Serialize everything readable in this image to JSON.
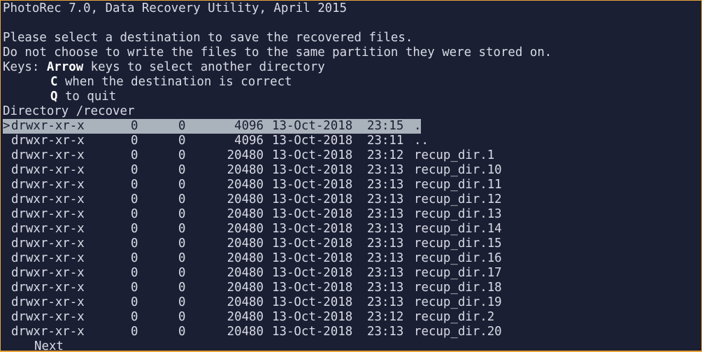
{
  "header": {
    "title": "PhotoRec 7.0, Data Recovery Utility, April 2015",
    "prompt1": "Please select a destination to save the recovered files.",
    "prompt2": "Do not choose to write the files to the same partition they were stored on.",
    "keys_label": "Keys: ",
    "keys": [
      {
        "key": "Arrow",
        "desc": " keys to select another directory"
      },
      {
        "key": "C",
        "desc": " when the destination is correct"
      },
      {
        "key": "Q",
        "desc": " to quit"
      }
    ],
    "directory": "Directory /recover"
  },
  "cursor": ">",
  "entries": [
    {
      "perm": "drwxr-xr-x",
      "uid": "0",
      "gid": "0",
      "size": "4096",
      "date": "13-Oct-2018",
      "time": "23:15",
      "name": "."
    },
    {
      "perm": "drwxr-xr-x",
      "uid": "0",
      "gid": "0",
      "size": "4096",
      "date": "13-Oct-2018",
      "time": "23:11",
      "name": ".."
    },
    {
      "perm": "drwxr-xr-x",
      "uid": "0",
      "gid": "0",
      "size": "20480",
      "date": "13-Oct-2018",
      "time": "23:12",
      "name": "recup_dir.1"
    },
    {
      "perm": "drwxr-xr-x",
      "uid": "0",
      "gid": "0",
      "size": "20480",
      "date": "13-Oct-2018",
      "time": "23:13",
      "name": "recup_dir.10"
    },
    {
      "perm": "drwxr-xr-x",
      "uid": "0",
      "gid": "0",
      "size": "20480",
      "date": "13-Oct-2018",
      "time": "23:13",
      "name": "recup_dir.11"
    },
    {
      "perm": "drwxr-xr-x",
      "uid": "0",
      "gid": "0",
      "size": "20480",
      "date": "13-Oct-2018",
      "time": "23:13",
      "name": "recup_dir.12"
    },
    {
      "perm": "drwxr-xr-x",
      "uid": "0",
      "gid": "0",
      "size": "20480",
      "date": "13-Oct-2018",
      "time": "23:13",
      "name": "recup_dir.13"
    },
    {
      "perm": "drwxr-xr-x",
      "uid": "0",
      "gid": "0",
      "size": "20480",
      "date": "13-Oct-2018",
      "time": "23:13",
      "name": "recup_dir.14"
    },
    {
      "perm": "drwxr-xr-x",
      "uid": "0",
      "gid": "0",
      "size": "20480",
      "date": "13-Oct-2018",
      "time": "23:13",
      "name": "recup_dir.15"
    },
    {
      "perm": "drwxr-xr-x",
      "uid": "0",
      "gid": "0",
      "size": "20480",
      "date": "13-Oct-2018",
      "time": "23:13",
      "name": "recup_dir.16"
    },
    {
      "perm": "drwxr-xr-x",
      "uid": "0",
      "gid": "0",
      "size": "20480",
      "date": "13-Oct-2018",
      "time": "23:13",
      "name": "recup_dir.17"
    },
    {
      "perm": "drwxr-xr-x",
      "uid": "0",
      "gid": "0",
      "size": "20480",
      "date": "13-Oct-2018",
      "time": "23:13",
      "name": "recup_dir.18"
    },
    {
      "perm": "drwxr-xr-x",
      "uid": "0",
      "gid": "0",
      "size": "20480",
      "date": "13-Oct-2018",
      "time": "23:13",
      "name": "recup_dir.19"
    },
    {
      "perm": "drwxr-xr-x",
      "uid": "0",
      "gid": "0",
      "size": "20480",
      "date": "13-Oct-2018",
      "time": "23:12",
      "name": "recup_dir.2"
    },
    {
      "perm": "drwxr-xr-x",
      "uid": "0",
      "gid": "0",
      "size": "20480",
      "date": "13-Oct-2018",
      "time": "23:13",
      "name": "recup_dir.20"
    }
  ],
  "footer": {
    "next_label": "Next"
  },
  "colors": {
    "background": "#1b1f33",
    "text": "#d8dbe6",
    "selection": "#aab3bc",
    "border": "#e8a33a"
  }
}
